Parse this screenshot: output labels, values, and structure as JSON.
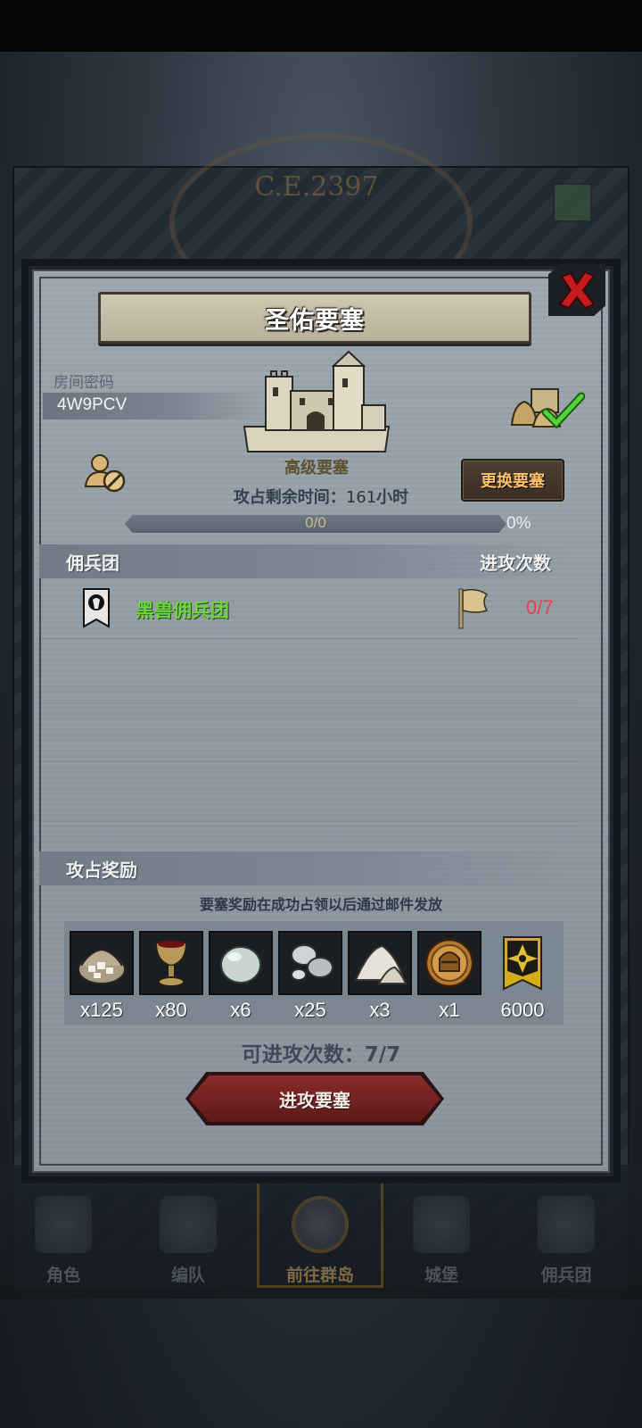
{
  "backdrop": {
    "era_label": "C.E.2397"
  },
  "bottom_nav": {
    "items": [
      {
        "label": "角色",
        "icon": "character-icon"
      },
      {
        "label": "编队",
        "icon": "formation-icon"
      },
      {
        "label": "前往群岛",
        "icon": "islands-icon",
        "active": true
      },
      {
        "label": "城堡",
        "icon": "castle-icon"
      },
      {
        "label": "佣兵团",
        "icon": "mercenary-icon"
      }
    ]
  },
  "modal": {
    "title": "圣佑要塞",
    "room": {
      "label": "房间密码",
      "code": "4W9PCV"
    },
    "fortress_type": "高级要塞",
    "change_button": "更换要塞",
    "occupy_time": {
      "label": "攻占剩余时间：",
      "value": "161",
      "unit": "小时"
    },
    "progress": {
      "text": "0/0",
      "percent_text": "0%",
      "fraction": 0
    },
    "mercenary_section": {
      "title": "佣兵团",
      "attacks_header": "进攻次数",
      "rows": [
        {
          "name": "黑兽佣兵团",
          "attacks": "0/7"
        }
      ]
    },
    "reward_section": {
      "title": "攻占奖励",
      "note": "要塞奖励在成功占领以后通过邮件发放",
      "items": [
        {
          "icon": "stone-sack-icon",
          "qty": "x125"
        },
        {
          "icon": "goblet-icon",
          "qty": "x80"
        },
        {
          "icon": "pearl-egg-icon",
          "qty": "x6"
        },
        {
          "icon": "silver-ore-icon",
          "qty": "x25"
        },
        {
          "icon": "salt-pile-icon",
          "qty": "x3"
        },
        {
          "icon": "knight-medal-icon",
          "qty": "x1"
        },
        {
          "icon": "honor-banner-icon",
          "qty": "6000"
        }
      ]
    },
    "attacks_left": "可进攻次数：7/7",
    "attack_button": "进攻要塞"
  },
  "colors": {
    "merc_name": "#6bd73b",
    "merc_attacks": "#e0464a",
    "change_button_text": "#ffc36a",
    "attack_button": "#7a2424"
  }
}
